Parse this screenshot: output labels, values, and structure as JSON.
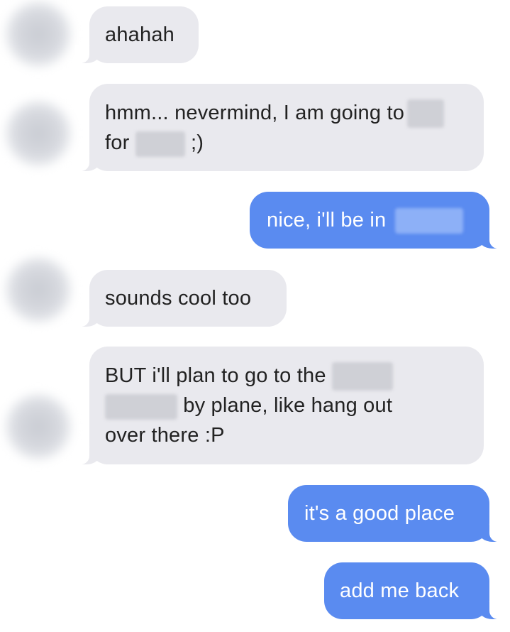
{
  "conversation": {
    "messages": [
      {
        "sender": "other",
        "text": "ahahah"
      },
      {
        "sender": "other",
        "line1": "hmm... nevermind, I am going to",
        "line2_prefix": "for",
        "line2_suffix": ";)"
      },
      {
        "sender": "self",
        "text": "nice, i'll be in"
      },
      {
        "sender": "other",
        "text": "sounds cool too"
      },
      {
        "sender": "other",
        "line1": "BUT i'll plan to go to the",
        "line2_suffix": "by plane, like hang out",
        "line3": "over there :P"
      },
      {
        "sender": "self",
        "text": "it's a good place"
      },
      {
        "sender": "self",
        "text": "add me back"
      }
    ]
  },
  "colors": {
    "received_bubble": "#e9e9ee",
    "sent_bubble": "#5a8bf0",
    "received_text": "#222222",
    "sent_text": "#ffffff"
  }
}
